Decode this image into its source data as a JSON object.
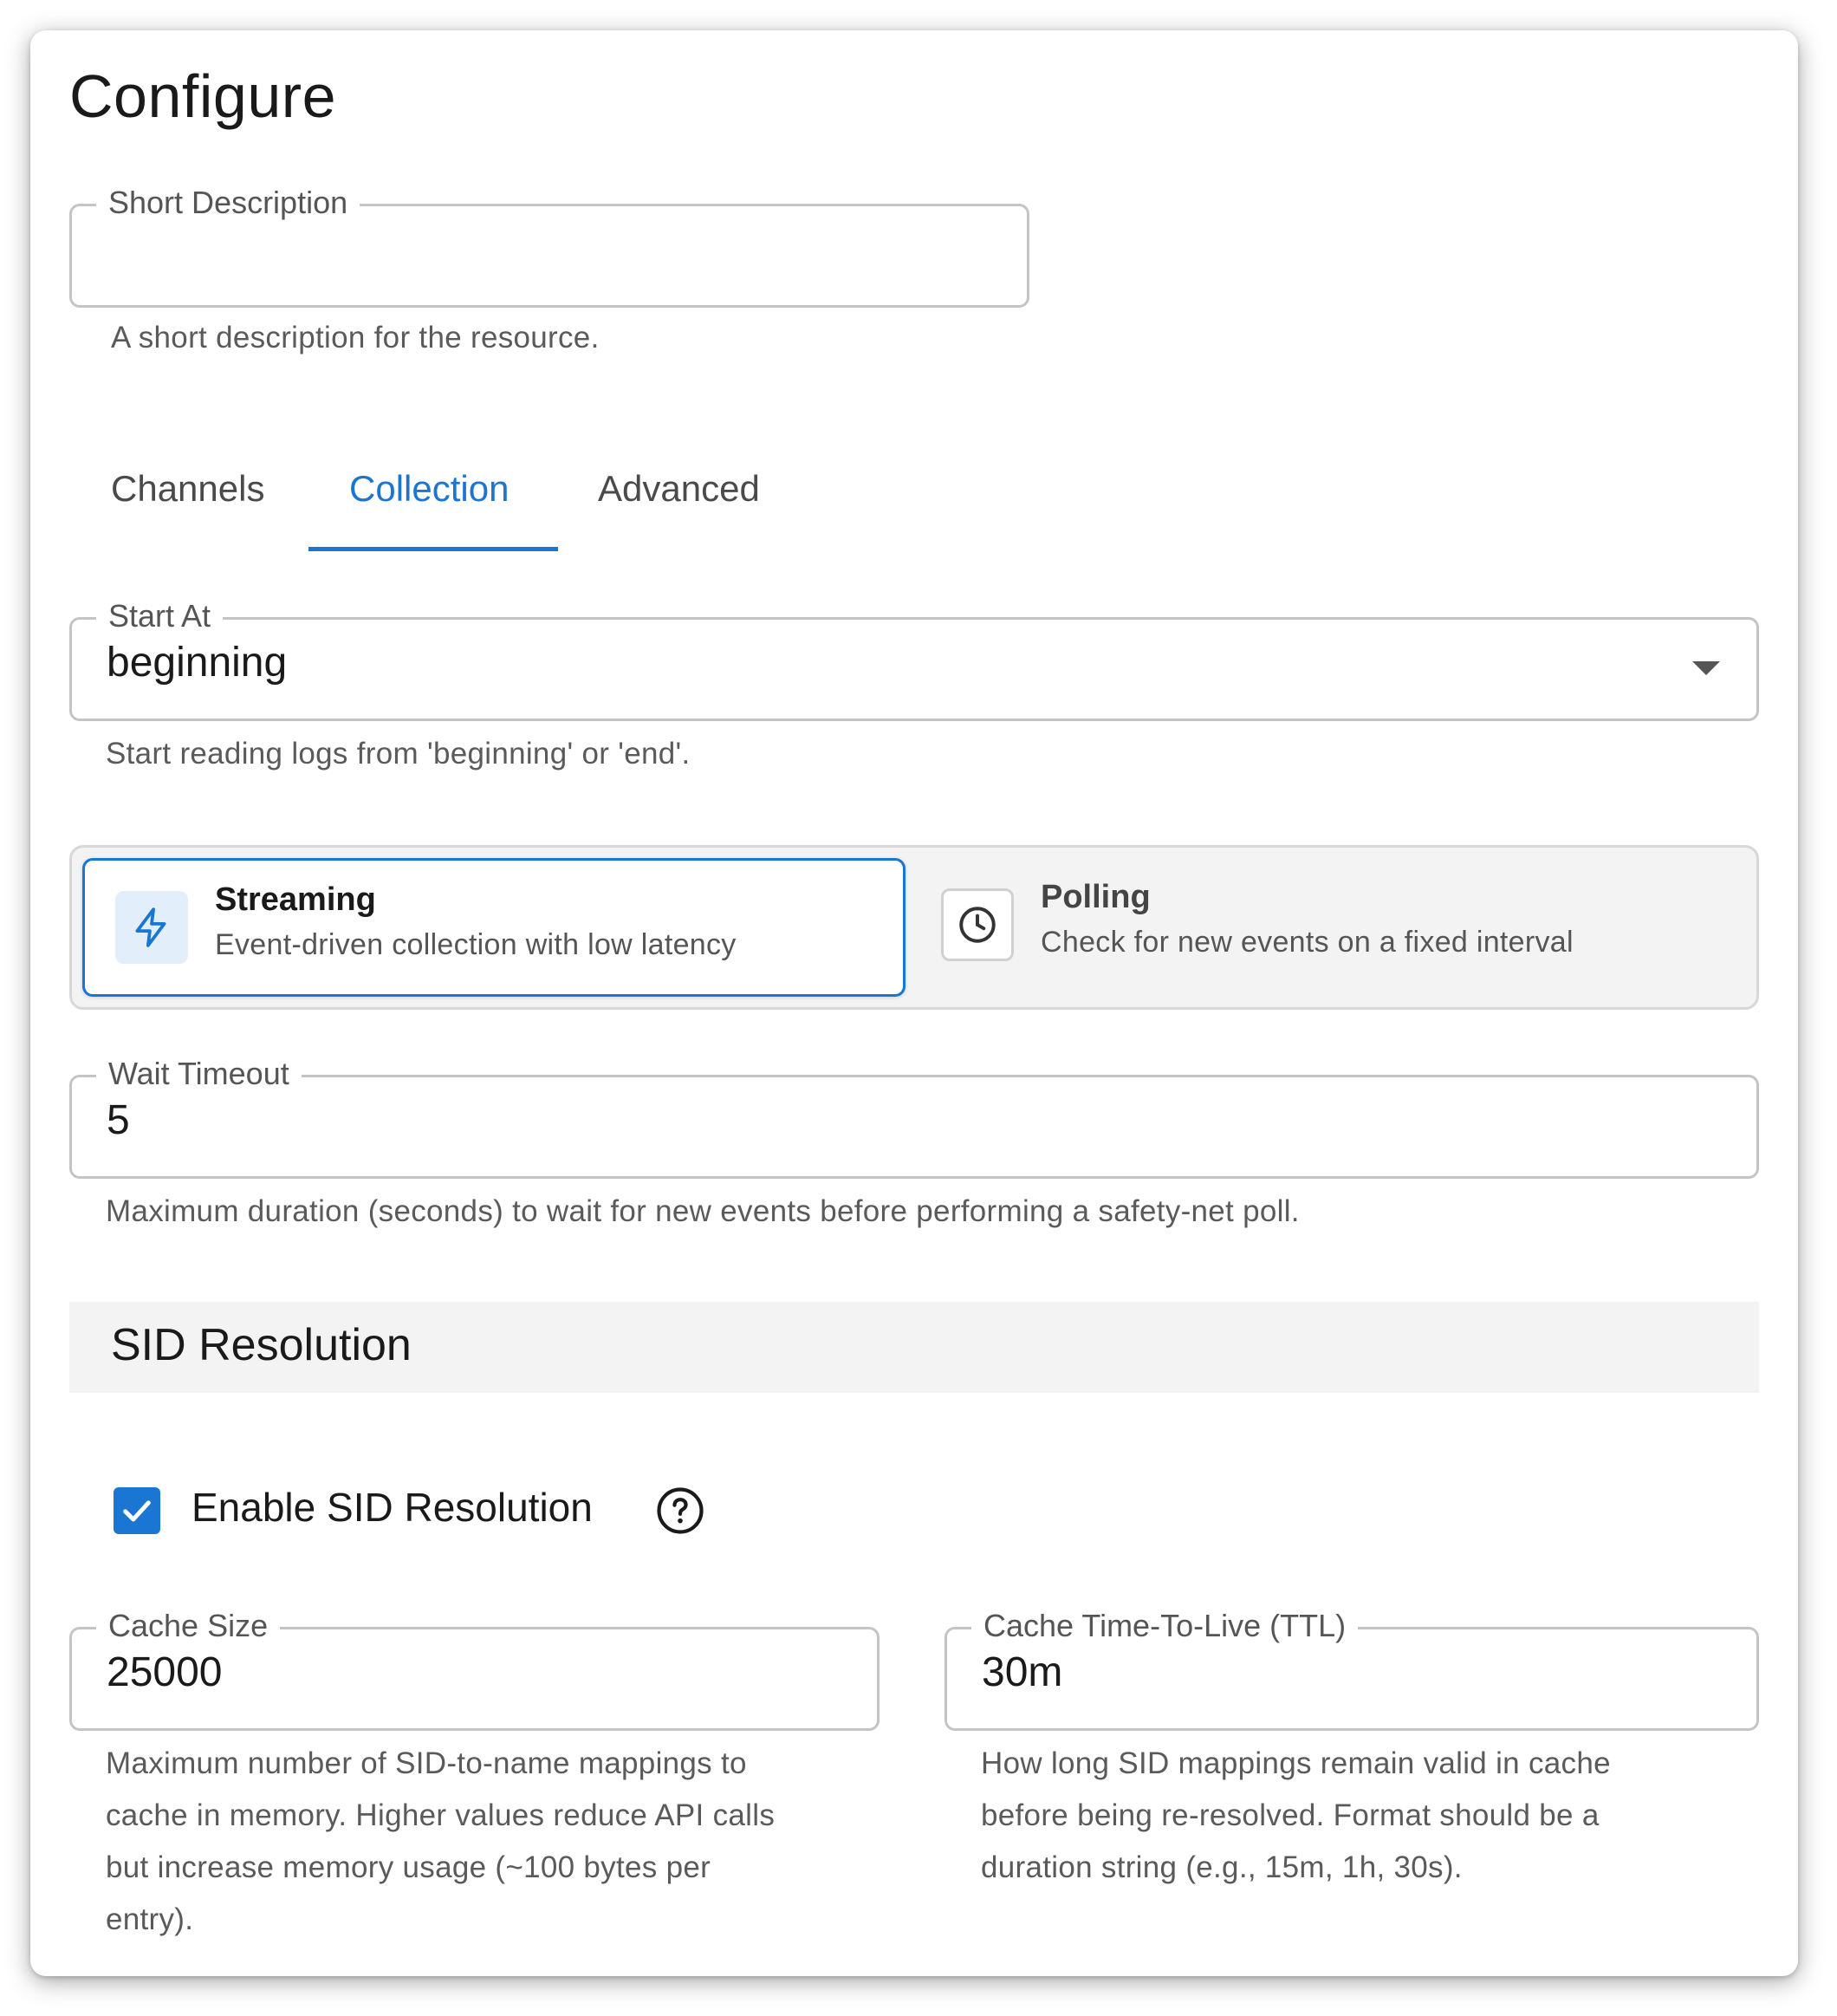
{
  "page": {
    "title": "Configure"
  },
  "short_description": {
    "label": "Short Description",
    "value": "",
    "helper": "A short description for the resource."
  },
  "tabs": [
    {
      "label": "Channels",
      "active": false
    },
    {
      "label": "Collection",
      "active": true
    },
    {
      "label": "Advanced",
      "active": false
    }
  ],
  "start_at": {
    "label": "Start At",
    "value": "beginning",
    "helper": "Start reading logs from 'beginning' or 'end'.",
    "icon": "chevron-down-icon"
  },
  "collection_mode": {
    "selected": "Streaming",
    "options": [
      {
        "title": "Streaming",
        "description": "Event-driven collection with low latency",
        "icon": "lightning-icon"
      },
      {
        "title": "Polling",
        "description": "Check for new events on a fixed interval",
        "icon": "clock-icon"
      }
    ]
  },
  "wait_timeout": {
    "label": "Wait Timeout",
    "value": "5",
    "helper": "Maximum duration (seconds) to wait for new events before performing a safety-net poll."
  },
  "sid_section": {
    "title": "SID Resolution",
    "enable_label": "Enable SID Resolution",
    "enabled": true,
    "help_icon": "question-circle-icon"
  },
  "cache_size": {
    "label": "Cache Size",
    "value": "25000",
    "helper_lines": [
      "Maximum number of SID-to-name mappings to",
      "cache in memory. Higher values reduce API calls",
      "but increase memory usage (~100 bytes per",
      "entry)."
    ]
  },
  "cache_ttl": {
    "label": "Cache Time-To-Live (TTL)",
    "value": "30m",
    "helper_lines": [
      "How long SID mappings remain valid in cache",
      "before being re-resolved. Format should be a",
      "duration string (e.g., 15m, 1h, 30s)."
    ]
  },
  "colors": {
    "accent": "#1976d2",
    "border": "#c4c4c4",
    "section_bg": "#f3f3f4"
  }
}
